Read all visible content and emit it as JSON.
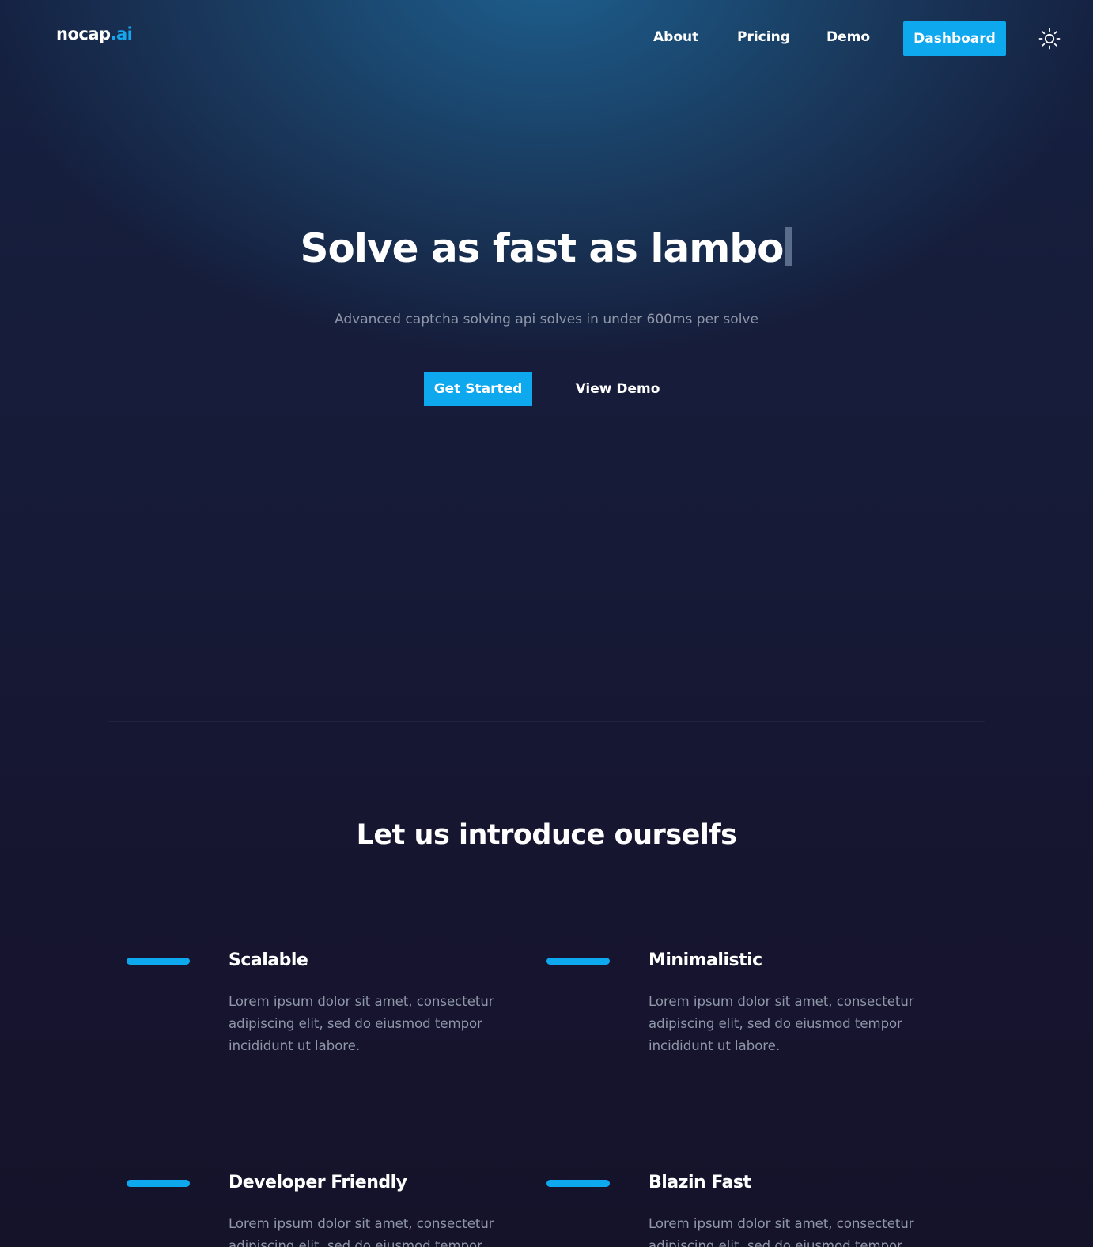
{
  "nav": {
    "logo_main": "nocap",
    "logo_accent": ".ai",
    "links": [
      "About",
      "Pricing",
      "Demo"
    ],
    "dashboard_label": "Dashboard",
    "theme_icon": "sun-icon"
  },
  "hero": {
    "title": "Solve as fast as lambo",
    "subtitle": "Advanced captcha solving api solves in under 600ms per solve",
    "primary_cta": "Get Started",
    "secondary_cta": "View Demo"
  },
  "intro": {
    "title": "Let us introduce ourselfs",
    "features": [
      {
        "title": "Scalable",
        "description": "Lorem ipsum dolor sit amet, consectetur adipiscing elit, sed do eiusmod tempor incididunt ut labore."
      },
      {
        "title": "Minimalistic",
        "description": "Lorem ipsum dolor sit amet, consectetur adipiscing elit, sed do eiusmod tempor incididunt ut labore."
      },
      {
        "title": "Developer Friendly",
        "description": "Lorem ipsum dolor sit amet, consectetur adipiscing elit, sed do eiusmod tempor incididunt ut labore."
      },
      {
        "title": "Blazin Fast",
        "description": "Lorem ipsum dolor sit amet, consectetur adipiscing elit, sed do eiusmod tempor incididunt ut labore."
      }
    ]
  },
  "colors": {
    "accent": "#0ea8ee",
    "background": "#15142a",
    "hero_glow": "#1e5f8d",
    "muted_text": "#8f97a8"
  }
}
